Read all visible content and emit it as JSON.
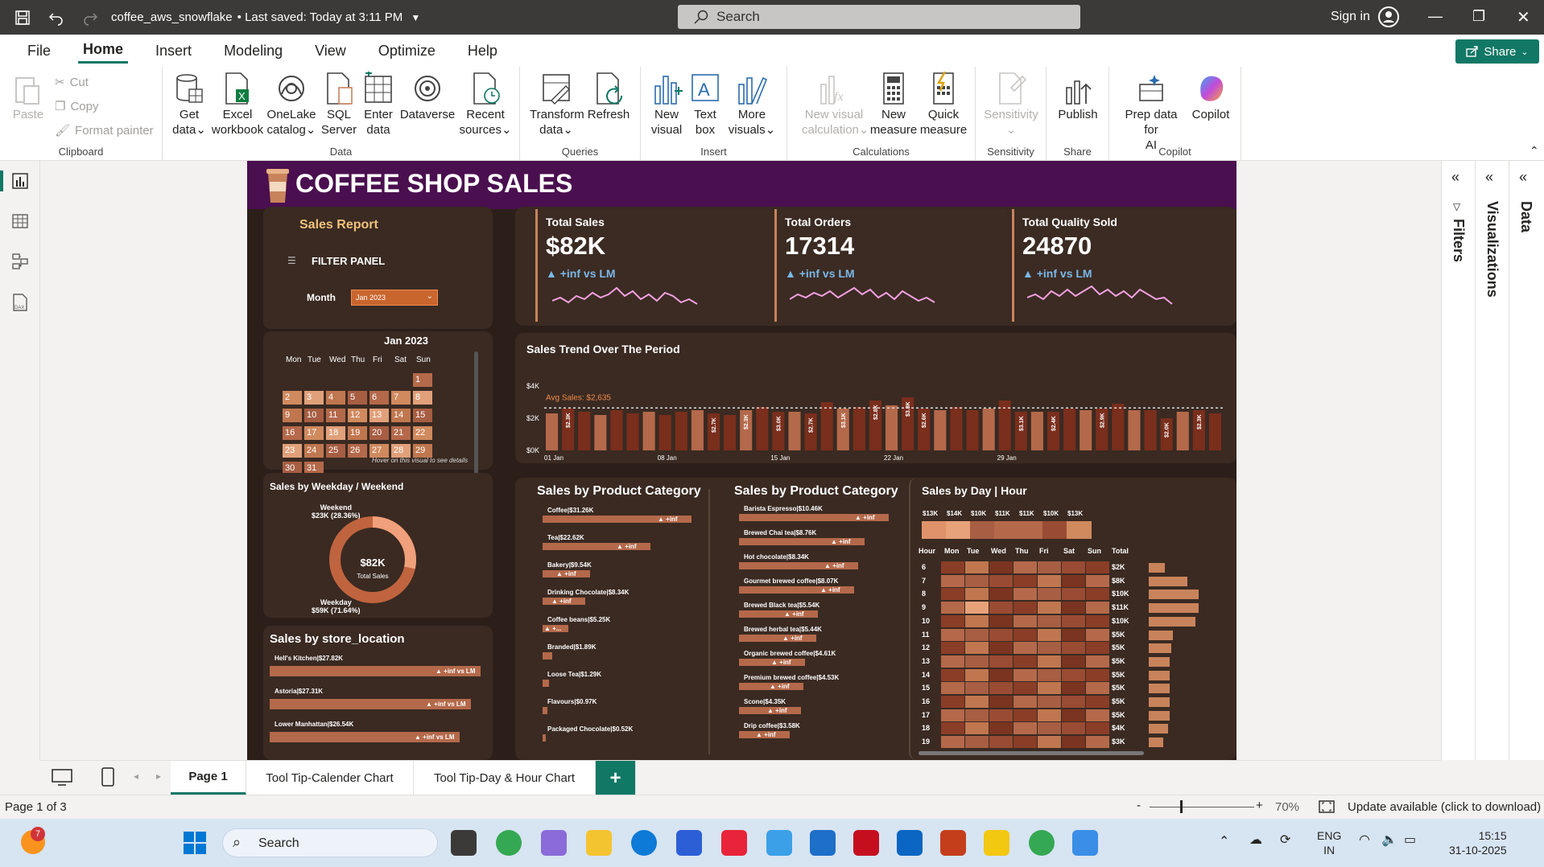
{
  "window": {
    "filename": "coffee_aws_snowflake",
    "saved": "• Last saved: Today at 3:11 PM",
    "search_placeholder": "Search",
    "sign_in": "Sign in"
  },
  "menu": {
    "tabs": [
      "File",
      "Home",
      "Insert",
      "Modeling",
      "View",
      "Optimize",
      "Help"
    ],
    "active": "Home",
    "share": "Share"
  },
  "ribbon": {
    "clipboard": {
      "name": "Clipboard",
      "paste": "Paste",
      "cut": "Cut",
      "copy": "Copy",
      "format_painter": "Format painter"
    },
    "data": {
      "name": "Data",
      "get_data": [
        "Get",
        "data"
      ],
      "excel": [
        "Excel",
        "workbook"
      ],
      "onelake": [
        "OneLake",
        "catalog"
      ],
      "sql": [
        "SQL",
        "Server"
      ],
      "enter": [
        "Enter",
        "data"
      ],
      "dataverse": "Dataverse",
      "recent": [
        "Recent",
        "sources"
      ]
    },
    "queries": {
      "name": "Queries",
      "transform": [
        "Transform",
        "data"
      ],
      "refresh": "Refresh"
    },
    "insert": {
      "name": "Insert",
      "new_visual": [
        "New",
        "visual"
      ],
      "text_box": [
        "Text",
        "box"
      ],
      "more_visuals": [
        "More",
        "visuals"
      ]
    },
    "calculations": {
      "name": "Calculations",
      "new_visual_calc": [
        "New visual",
        "calculation"
      ],
      "new_measure": [
        "New",
        "measure"
      ],
      "quick_measure": [
        "Quick",
        "measure"
      ]
    },
    "sensitivity": {
      "name": "Sensitivity",
      "label": "Sensitivity"
    },
    "share": {
      "name": "Share",
      "publish": "Publish"
    },
    "copilot": {
      "name": "Copilot",
      "prep": [
        "Prep data for",
        "AI"
      ],
      "copilot": "Copilot"
    }
  },
  "panes": {
    "filters": "Filters",
    "visualizations": "Visualizations",
    "data": "Data"
  },
  "report": {
    "title": "COFFEE SHOP SALES",
    "filter_panel": {
      "sales_report": "Sales Report",
      "filter_panel": "FILTER PANEL",
      "month_label": "Month",
      "month_value": "Jan 2023"
    },
    "calendar": {
      "title": "Jan 2023",
      "weekdays": [
        "Mon",
        "Tue",
        "Wed",
        "Thu",
        "Fri",
        "Sat",
        "Sun"
      ],
      "hover_hint": "Hover on this visual to see details",
      "days": [
        "1",
        "2",
        "3",
        "4",
        "5",
        "6",
        "7",
        "8",
        "9",
        "10",
        "11",
        "12",
        "13",
        "14",
        "15",
        "16",
        "17",
        "18",
        "19",
        "20",
        "21",
        "22",
        "23",
        "24",
        "25",
        "26",
        "27",
        "28",
        "29",
        "30",
        "31"
      ]
    },
    "kpis": [
      {
        "label": "Total Sales",
        "value": "$82K",
        "change": "▲ +inf vs LM"
      },
      {
        "label": "Total Orders",
        "value": "17314",
        "change": "▲ +inf vs LM"
      },
      {
        "label": "Total Quality Sold",
        "value": "24870",
        "change": "▲ +inf vs LM"
      }
    ],
    "trend": {
      "title": "Sales Trend Over The Period",
      "y_ticks": [
        "$4K",
        "$2K",
        "$0K"
      ],
      "avg_label": "Avg Sales: $2,635",
      "x_ticks": [
        "01 Jan",
        "08 Jan",
        "15 Jan",
        "22 Jan",
        "29 Jan"
      ],
      "bar_labels": [
        "$2.3K",
        "$2.7K",
        "$2.3K",
        "$3.0K",
        "$2.7K",
        "$3.1K",
        "$2.8K",
        "$3.3K",
        "$2.6K",
        "$3.1K",
        "$2.4K",
        "$2.9K",
        "$2.0K",
        "$2.3K"
      ]
    },
    "weekday": {
      "title": "Sales by Weekday / Weekend",
      "weekend_label": "Weekend",
      "weekend_value": "$23K (28.36%)",
      "weekday_label": "Weekday",
      "weekday_value": "$59K (71.64%)",
      "center_value": "$82K",
      "center_label": "Total Sales"
    },
    "store": {
      "title": "Sales by store_location",
      "items": [
        {
          "label": "Hell's Kitchen|$27.82K",
          "tag": "▲ +inf vs LM"
        },
        {
          "label": "Astoria|$27.31K",
          "tag": "▲ +inf vs LM"
        },
        {
          "label": "Lower Manhattan|$26.54K",
          "tag": "▲ +inf vs LM"
        }
      ]
    },
    "category": {
      "title": "Sales by Product Category",
      "items": [
        {
          "label": "Coffee|$31.26K",
          "tag": "▲ +inf"
        },
        {
          "label": "Tea|$22.62K",
          "tag": "▲ +inf"
        },
        {
          "label": "Bakery|$9.54K",
          "tag": "▲ +inf"
        },
        {
          "label": "Drinking Chocolate|$8.34K",
          "tag": "▲ +inf"
        },
        {
          "label": "Coffee beans|$5.25K",
          "tag": "▲ +..."
        },
        {
          "label": "Branded|$1.89K",
          "tag": ""
        },
        {
          "label": "Loose Tea|$1.29K",
          "tag": ""
        },
        {
          "label": "Flavours|$0.97K",
          "tag": ""
        },
        {
          "label": "Packaged Chocolate|$0.52K",
          "tag": ""
        }
      ]
    },
    "product_type": {
      "title": "Sales by Product Category",
      "items": [
        {
          "label": "Barista Espresso|$10.46K",
          "tag": "▲ +inf"
        },
        {
          "label": "Brewed Chai tea|$8.76K",
          "tag": "▲ +inf"
        },
        {
          "label": "Hot chocolate|$8.34K",
          "tag": "▲ +inf"
        },
        {
          "label": "Gourmet brewed coffee|$8.07K",
          "tag": "▲ +inf"
        },
        {
          "label": "Brewed Black tea|$5.54K",
          "tag": "▲ +inf"
        },
        {
          "label": "Brewed herbal tea|$5.44K",
          "tag": "▲ +inf"
        },
        {
          "label": "Organic brewed coffee|$4.61K",
          "tag": "▲ +inf"
        },
        {
          "label": "Premium brewed coffee|$4.53K",
          "tag": "▲ +inf"
        },
        {
          "label": "Scone|$4.35K",
          "tag": "▲ +inf"
        },
        {
          "label": "Drip coffee|$3.58K",
          "tag": "▲ +inf"
        }
      ]
    },
    "dayhour": {
      "title": "Sales by Day | Hour",
      "day_totals": [
        "$13K",
        "$14K",
        "$10K",
        "$11K",
        "$11K",
        "$10K",
        "$13K"
      ],
      "columns": [
        "Hour",
        "Mon",
        "Tue",
        "Wed",
        "Thu",
        "Fri",
        "Sat",
        "Sun",
        "Total"
      ],
      "hours": [
        "6",
        "7",
        "8",
        "9",
        "10",
        "11",
        "12",
        "13",
        "14",
        "15",
        "16",
        "17",
        "18",
        "19"
      ],
      "totals": [
        "$2K",
        "$8K",
        "$10K",
        "$11K",
        "$10K",
        "$5K",
        "$5K",
        "$5K",
        "$5K",
        "$5K",
        "$5K",
        "$5K",
        "$4K",
        "$3K"
      ]
    }
  },
  "pages": {
    "tabs": [
      "Page 1",
      "Tool Tip-Calender Chart",
      "Tool Tip-Day & Hour Chart"
    ],
    "add": "+"
  },
  "status": {
    "page": "Page 1 of 3",
    "zoom": "70%",
    "update": "Update available (click to download)"
  },
  "taskbar": {
    "search": "Search",
    "badge": "7",
    "lang1": "ENG",
    "lang2": "IN",
    "time": "15:15",
    "date": "31-10-2025"
  },
  "chart_data": [
    {
      "type": "bar",
      "title": "Sales Trend Over The Period",
      "x": [
        "01 Jan",
        "08 Jan",
        "15 Jan",
        "22 Jan",
        "29 Jan"
      ],
      "ylim": [
        0,
        4000
      ],
      "avg": 2635,
      "values": [
        2300,
        2600,
        2400,
        2200,
        2500,
        2300,
        2400,
        2200,
        2400,
        2500,
        2300,
        2200,
        2500,
        2700,
        2400,
        2400,
        2300,
        3000,
        2600,
        2700,
        3100,
        2800,
        3300,
        2600,
        2500,
        2700,
        2500,
        2600,
        3100,
        2400,
        2400,
        2400,
        2600,
        2500,
        2600,
        2900,
        2500,
        2500,
        2000,
        2400,
        2500,
        2300
      ]
    }
  ]
}
